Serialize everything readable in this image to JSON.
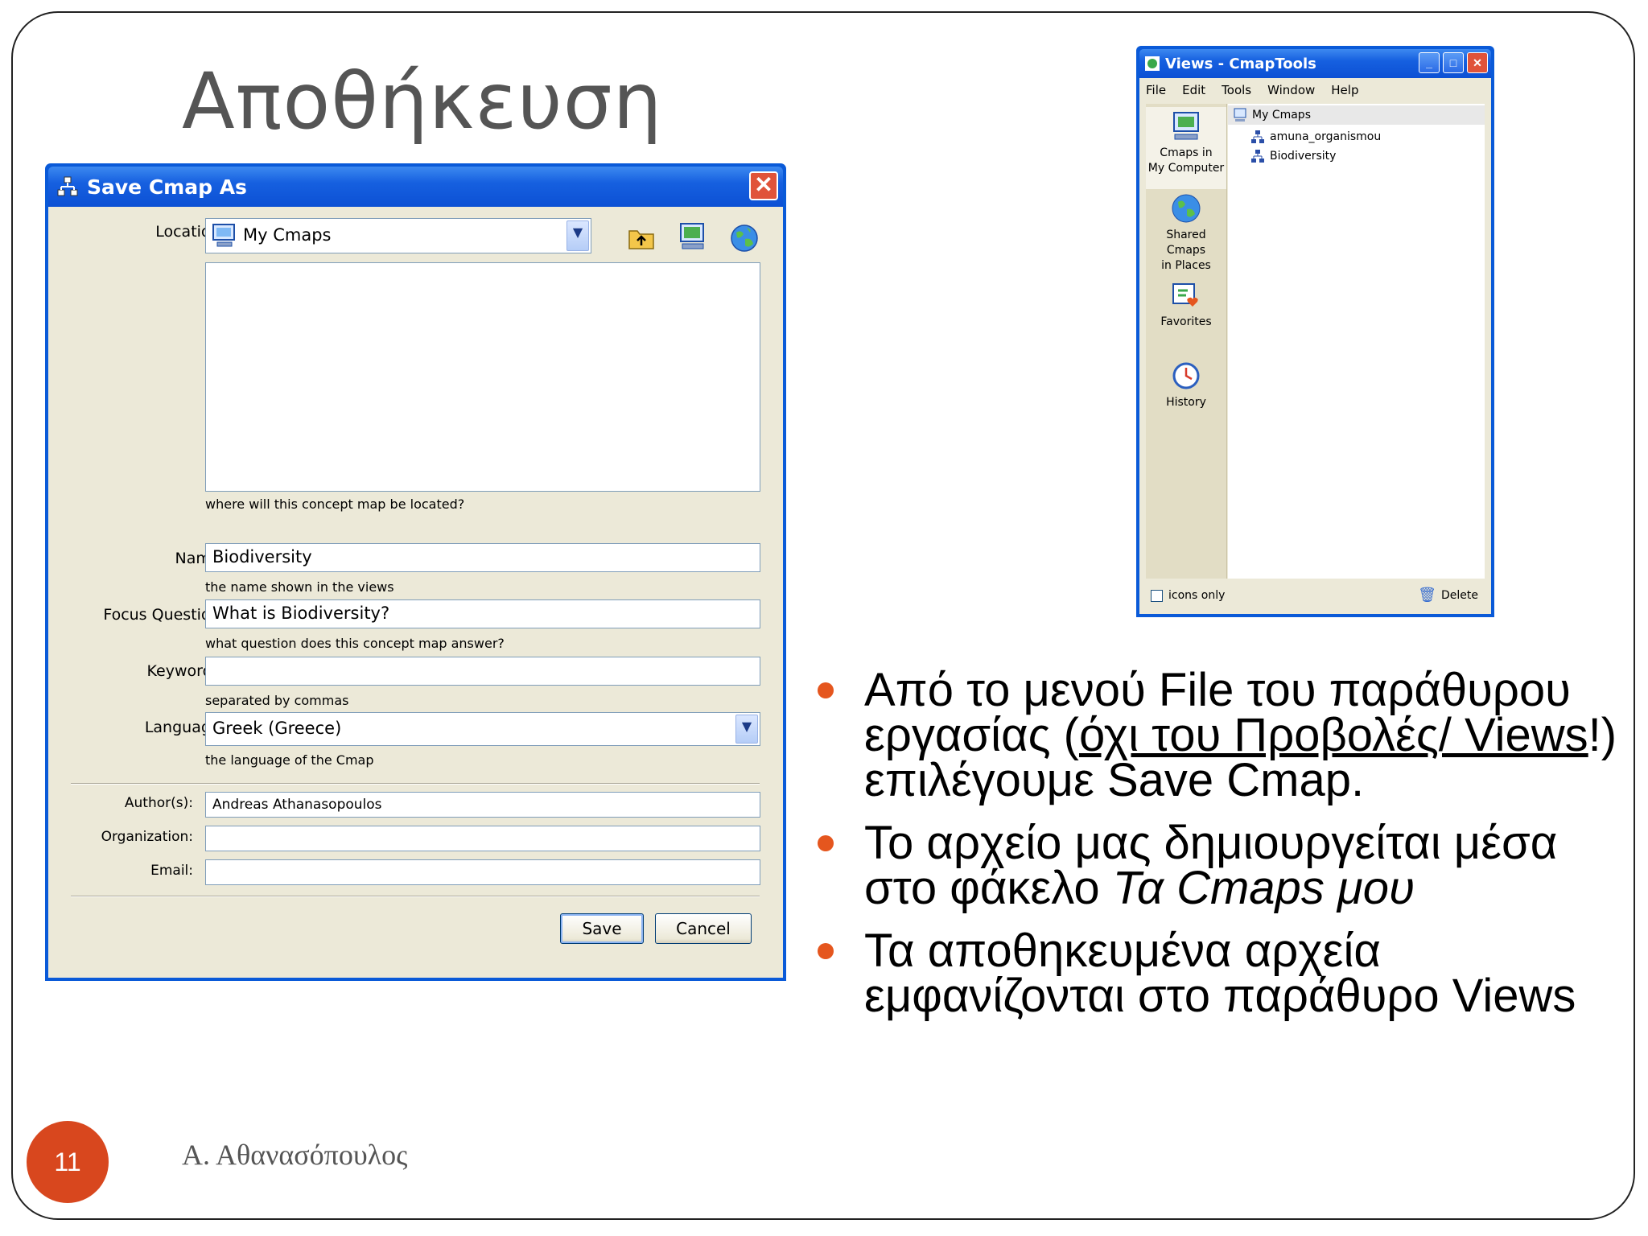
{
  "slide": {
    "title": "Αποθήκευση",
    "page_number": "11",
    "author": "Α. Αθανασόπουλος"
  },
  "save_dialog": {
    "title": "Save Cmap As",
    "location_label": "Location:",
    "location_value": "My Cmaps",
    "location_hint": "where will this concept map be located?",
    "name_label": "Name:",
    "name_value": "Biodiversity",
    "name_hint": "the name shown in the views",
    "focus_label": "Focus Question:",
    "focus_value": "What is Biodiversity?",
    "focus_hint": "what question does this concept map answer?",
    "keywords_label": "Keywords:",
    "keywords_value": "",
    "keywords_hint": "separated by commas",
    "language_label": "Language:",
    "language_value": "Greek (Greece)",
    "language_hint": "the language of the Cmap",
    "authors_label": "Author(s):",
    "authors_value": "Andreas Athanasopoulos",
    "organization_label": "Organization:",
    "organization_value": "",
    "email_label": "Email:",
    "email_value": "",
    "save_label": "Save",
    "cancel_label": "Cancel"
  },
  "views_window": {
    "title": "Views - CmapTools",
    "menu": [
      "File",
      "Edit",
      "Tools",
      "Window",
      "Help"
    ],
    "sidebar": [
      {
        "label_1": "Cmaps in",
        "label_2": "My Computer"
      },
      {
        "label_1": "Shared Cmaps",
        "label_2": "in Places"
      },
      {
        "label_1": "Favorites",
        "label_2": ""
      },
      {
        "label_1": "History",
        "label_2": ""
      }
    ],
    "tree": {
      "root": "My Cmaps",
      "children": [
        "amuna_organismou",
        "Biodiversity"
      ]
    },
    "icons_only_label": "icons only",
    "delete_label": "Delete"
  },
  "bullets": {
    "b1_pre": "Από το μενού File του παράθυρου εργασίας (",
    "b1_underlined": "όχι του Προβολές/ Views",
    "b1_post": "!) επιλέγουμε Save Cmap.",
    "b2_pre": "Το αρχείο μας δημιουργείται μέσα στο φάκελο ",
    "b2_italic": "Τα Cmaps μου",
    "b3": "Τα αποθηκευμένα αρχεία εμφανίζονται στο παράθυρο Views"
  },
  "colors": {
    "accent": "#e5561e",
    "xp_blue": "#0a5ad8",
    "dialog_bg": "#ece9d8"
  }
}
